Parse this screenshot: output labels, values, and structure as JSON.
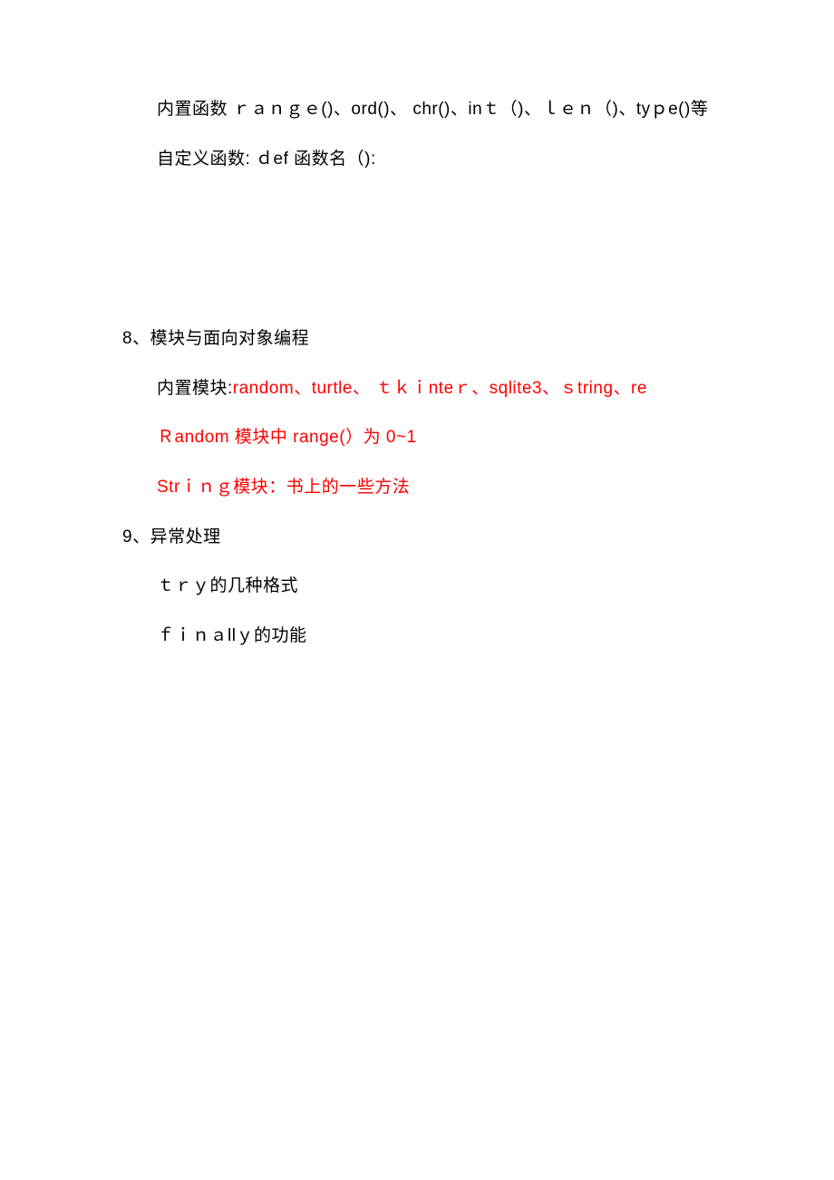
{
  "lines": [
    {
      "text": "内置函数 ｒａｎｇｅ()、ord()、 chr()、inｔ（)、ｌｅｎ（)、tyｐe()等",
      "class": "indent black gap-medium"
    },
    {
      "text": "自定义函数:  ｄef  函数名（):",
      "class": "indent black gap-large"
    },
    {
      "text": "8、模块与面向对象编程",
      "class": "heading black gap-medium"
    },
    {
      "parts": [
        {
          "text": "内置模块:",
          "color": "black"
        },
        {
          "text": "random、turtle、 ｔｋｉnteｒ、sqlite3、ｓtring、re",
          "color": "red"
        }
      ],
      "class": "indent gap-medium"
    },
    {
      "text": "Ｒandom 模块中 range(）为 0~1",
      "class": "indent red gap-medium"
    },
    {
      "text": "Strｉｎｇ模块：书上的一些方法",
      "class": "indent red gap-medium"
    },
    {
      "text": "9、异常处理",
      "class": "heading black gap-medium"
    },
    {
      "text": "ｔｒｙ的几种格式",
      "class": "indent black gap-medium"
    },
    {
      "text": "ｆｉｎａllｙ的功能",
      "class": "indent black gap-medium"
    }
  ]
}
